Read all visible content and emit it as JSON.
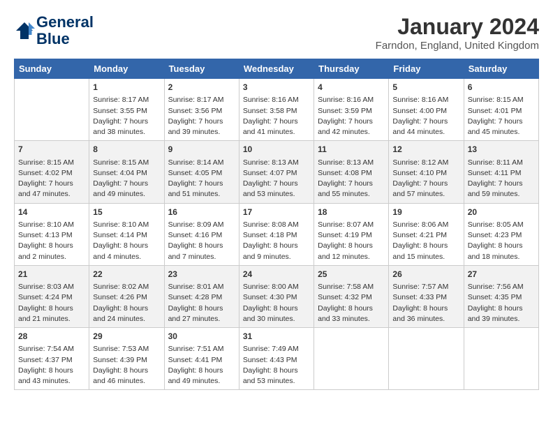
{
  "header": {
    "logo_line1": "General",
    "logo_line2": "Blue",
    "month": "January 2024",
    "location": "Farndon, England, United Kingdom"
  },
  "days_of_week": [
    "Sunday",
    "Monday",
    "Tuesday",
    "Wednesday",
    "Thursday",
    "Friday",
    "Saturday"
  ],
  "weeks": [
    [
      {
        "day": "",
        "info": ""
      },
      {
        "day": "1",
        "info": "Sunrise: 8:17 AM\nSunset: 3:55 PM\nDaylight: 7 hours\nand 38 minutes."
      },
      {
        "day": "2",
        "info": "Sunrise: 8:17 AM\nSunset: 3:56 PM\nDaylight: 7 hours\nand 39 minutes."
      },
      {
        "day": "3",
        "info": "Sunrise: 8:16 AM\nSunset: 3:58 PM\nDaylight: 7 hours\nand 41 minutes."
      },
      {
        "day": "4",
        "info": "Sunrise: 8:16 AM\nSunset: 3:59 PM\nDaylight: 7 hours\nand 42 minutes."
      },
      {
        "day": "5",
        "info": "Sunrise: 8:16 AM\nSunset: 4:00 PM\nDaylight: 7 hours\nand 44 minutes."
      },
      {
        "day": "6",
        "info": "Sunrise: 8:15 AM\nSunset: 4:01 PM\nDaylight: 7 hours\nand 45 minutes."
      }
    ],
    [
      {
        "day": "7",
        "info": "Sunrise: 8:15 AM\nSunset: 4:02 PM\nDaylight: 7 hours\nand 47 minutes."
      },
      {
        "day": "8",
        "info": "Sunrise: 8:15 AM\nSunset: 4:04 PM\nDaylight: 7 hours\nand 49 minutes."
      },
      {
        "day": "9",
        "info": "Sunrise: 8:14 AM\nSunset: 4:05 PM\nDaylight: 7 hours\nand 51 minutes."
      },
      {
        "day": "10",
        "info": "Sunrise: 8:13 AM\nSunset: 4:07 PM\nDaylight: 7 hours\nand 53 minutes."
      },
      {
        "day": "11",
        "info": "Sunrise: 8:13 AM\nSunset: 4:08 PM\nDaylight: 7 hours\nand 55 minutes."
      },
      {
        "day": "12",
        "info": "Sunrise: 8:12 AM\nSunset: 4:10 PM\nDaylight: 7 hours\nand 57 minutes."
      },
      {
        "day": "13",
        "info": "Sunrise: 8:11 AM\nSunset: 4:11 PM\nDaylight: 7 hours\nand 59 minutes."
      }
    ],
    [
      {
        "day": "14",
        "info": "Sunrise: 8:10 AM\nSunset: 4:13 PM\nDaylight: 8 hours\nand 2 minutes."
      },
      {
        "day": "15",
        "info": "Sunrise: 8:10 AM\nSunset: 4:14 PM\nDaylight: 8 hours\nand 4 minutes."
      },
      {
        "day": "16",
        "info": "Sunrise: 8:09 AM\nSunset: 4:16 PM\nDaylight: 8 hours\nand 7 minutes."
      },
      {
        "day": "17",
        "info": "Sunrise: 8:08 AM\nSunset: 4:18 PM\nDaylight: 8 hours\nand 9 minutes."
      },
      {
        "day": "18",
        "info": "Sunrise: 8:07 AM\nSunset: 4:19 PM\nDaylight: 8 hours\nand 12 minutes."
      },
      {
        "day": "19",
        "info": "Sunrise: 8:06 AM\nSunset: 4:21 PM\nDaylight: 8 hours\nand 15 minutes."
      },
      {
        "day": "20",
        "info": "Sunrise: 8:05 AM\nSunset: 4:23 PM\nDaylight: 8 hours\nand 18 minutes."
      }
    ],
    [
      {
        "day": "21",
        "info": "Sunrise: 8:03 AM\nSunset: 4:24 PM\nDaylight: 8 hours\nand 21 minutes."
      },
      {
        "day": "22",
        "info": "Sunrise: 8:02 AM\nSunset: 4:26 PM\nDaylight: 8 hours\nand 24 minutes."
      },
      {
        "day": "23",
        "info": "Sunrise: 8:01 AM\nSunset: 4:28 PM\nDaylight: 8 hours\nand 27 minutes."
      },
      {
        "day": "24",
        "info": "Sunrise: 8:00 AM\nSunset: 4:30 PM\nDaylight: 8 hours\nand 30 minutes."
      },
      {
        "day": "25",
        "info": "Sunrise: 7:58 AM\nSunset: 4:32 PM\nDaylight: 8 hours\nand 33 minutes."
      },
      {
        "day": "26",
        "info": "Sunrise: 7:57 AM\nSunset: 4:33 PM\nDaylight: 8 hours\nand 36 minutes."
      },
      {
        "day": "27",
        "info": "Sunrise: 7:56 AM\nSunset: 4:35 PM\nDaylight: 8 hours\nand 39 minutes."
      }
    ],
    [
      {
        "day": "28",
        "info": "Sunrise: 7:54 AM\nSunset: 4:37 PM\nDaylight: 8 hours\nand 43 minutes."
      },
      {
        "day": "29",
        "info": "Sunrise: 7:53 AM\nSunset: 4:39 PM\nDaylight: 8 hours\nand 46 minutes."
      },
      {
        "day": "30",
        "info": "Sunrise: 7:51 AM\nSunset: 4:41 PM\nDaylight: 8 hours\nand 49 minutes."
      },
      {
        "day": "31",
        "info": "Sunrise: 7:49 AM\nSunset: 4:43 PM\nDaylight: 8 hours\nand 53 minutes."
      },
      {
        "day": "",
        "info": ""
      },
      {
        "day": "",
        "info": ""
      },
      {
        "day": "",
        "info": ""
      }
    ]
  ]
}
